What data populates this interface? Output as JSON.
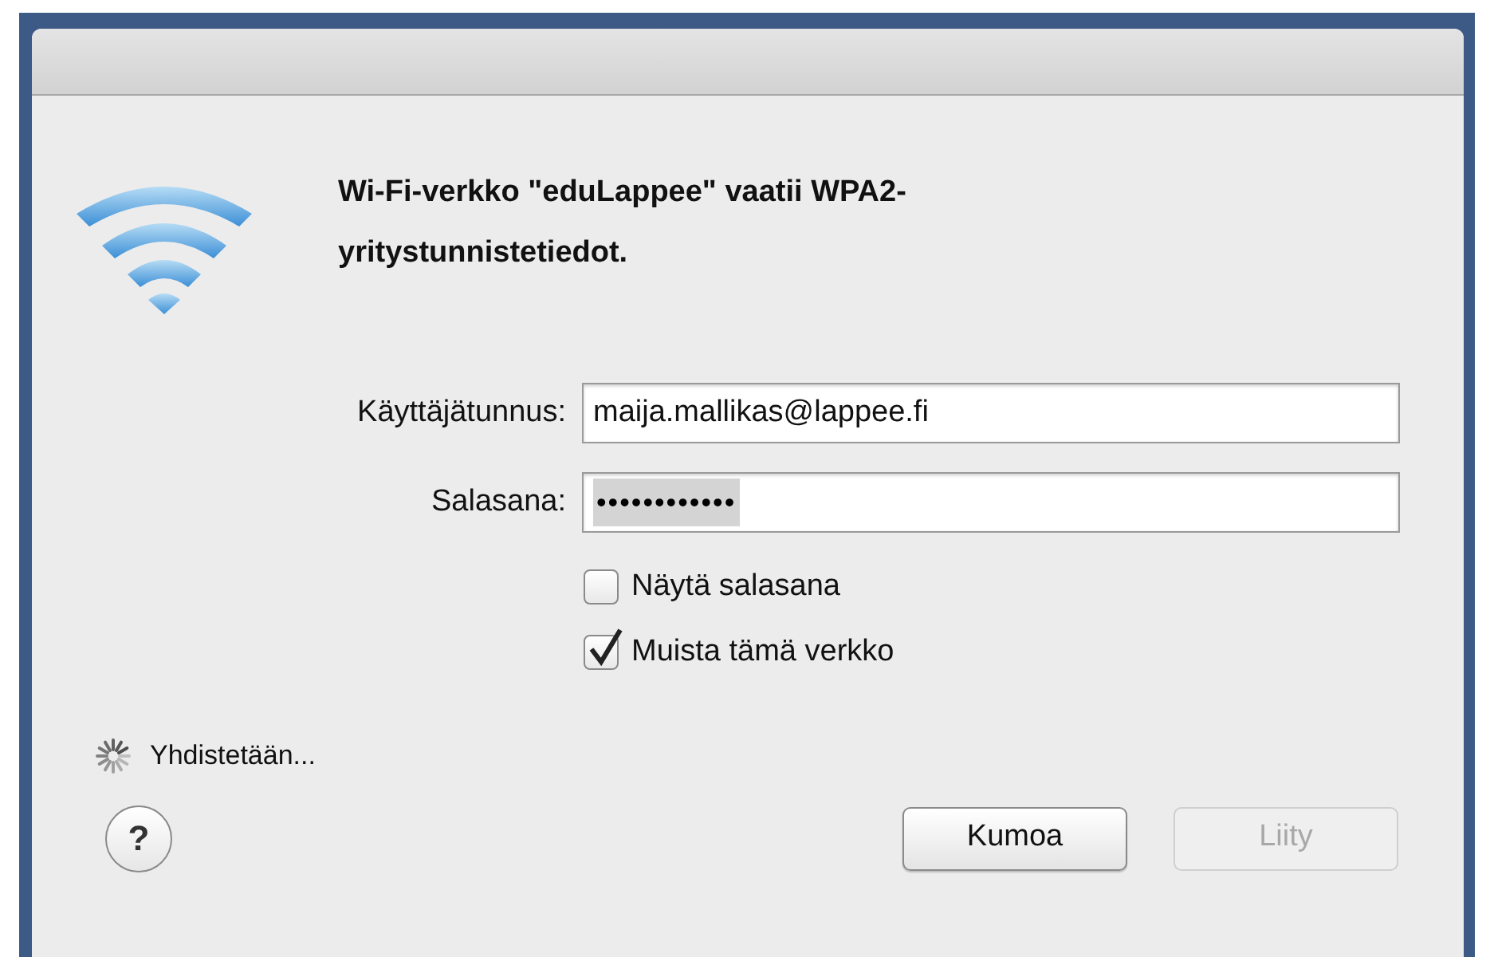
{
  "message": {
    "text": "Wi-Fi-verkko \"eduLappee\" vaatii WPA2-yritystunnistetiedot."
  },
  "fields": [
    {
      "label": "Käyttäjätunnus:",
      "value": "maija.mallikas@lappee.fi",
      "selected": false
    },
    {
      "label": "Salasana:",
      "value": "••••••••••••",
      "selected": true
    }
  ],
  "checkboxes": [
    {
      "label": "Näytä salasana",
      "checked": false
    },
    {
      "label": "Muista tämä verkko",
      "checked": true
    }
  ],
  "status": {
    "text": "Yhdistetään..."
  },
  "help": {
    "label": "?"
  },
  "buttons": [
    {
      "label": "Kumoa",
      "disabled": false
    },
    {
      "label": "Liity",
      "disabled": true
    }
  ]
}
